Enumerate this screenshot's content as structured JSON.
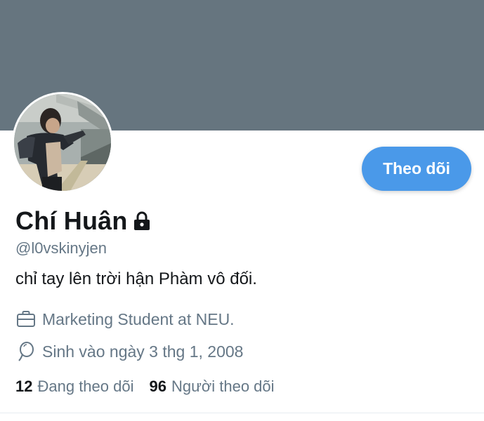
{
  "profile": {
    "display_name": "Chí Huân",
    "handle": "@l0vskinyjen",
    "bio": "chỉ tay lên trời hận Phàm vô đối.",
    "work": "Marketing Student at NEU.",
    "birthday": "Sinh vào ngày 3 thg 1, 2008",
    "protected": true
  },
  "actions": {
    "follow_label": "Theo dõi"
  },
  "stats": {
    "following_count": "12",
    "following_label": "Đang theo dõi",
    "followers_count": "96",
    "followers_label": "Người theo dõi"
  },
  "icons": {
    "lock": "lock-icon",
    "work": "briefcase-icon",
    "birthday": "balloon-icon"
  },
  "colors": {
    "banner": "#66757f",
    "accent": "#4a99e9",
    "text_primary": "#14171a",
    "text_secondary": "#657786"
  }
}
